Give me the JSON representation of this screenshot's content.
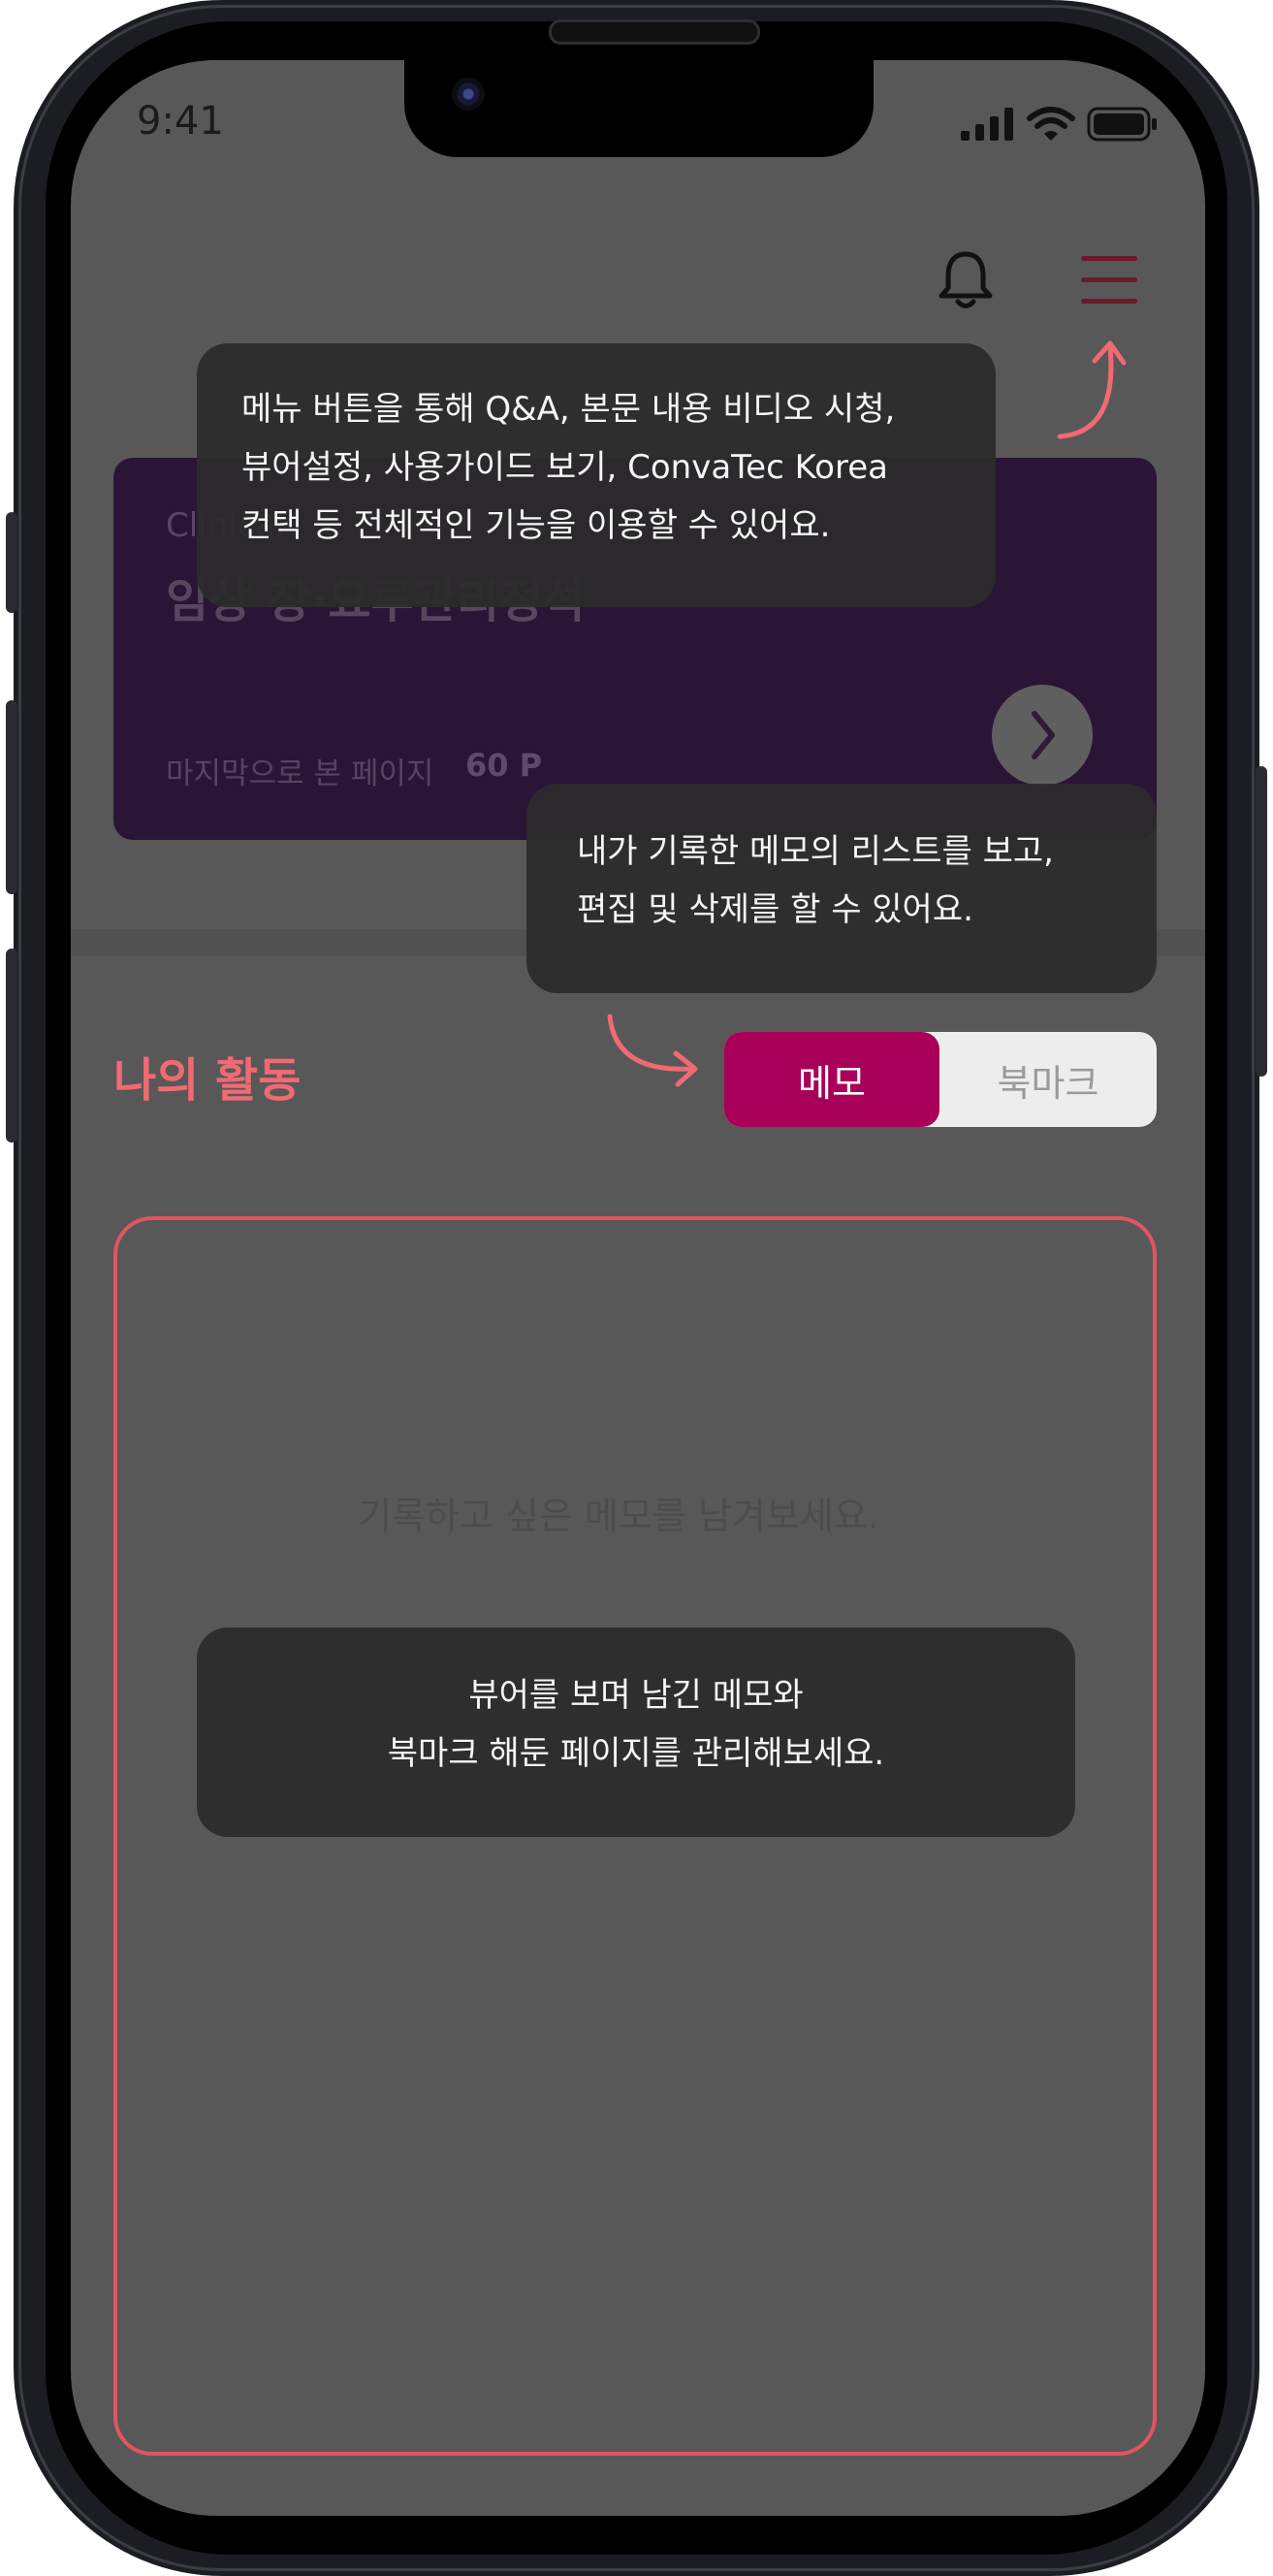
{
  "status_bar": {
    "time": "9:41"
  },
  "colors": {
    "accent_red": "#f06a73",
    "memo_tab_active": "#a80058",
    "card_bg": "#2a1536",
    "overlay": "#585858"
  },
  "header": {
    "notification_icon": "bell-icon",
    "menu_icon": "hamburger-menu-icon"
  },
  "book_card": {
    "subtitle": "Clinical",
    "title": "임상 장·요루관리정석",
    "last_viewed_label": "마지막으로 본 페이지",
    "last_viewed_page": "60 P",
    "arrow_icon": "chevron-right-icon"
  },
  "activity": {
    "title": "나의 활동",
    "tabs": [
      {
        "label": "메모",
        "selected": true
      },
      {
        "label": "북마크",
        "selected": false
      }
    ],
    "empty_message": "기록하고 싶은 메모를 남겨보세요."
  },
  "tooltips": {
    "menu": [
      "메뉴 버튼을 통해 Q&A, 본문 내용 비디오 시청,",
      "뷰어설정, 사용가이드 보기,  ConvaTec Korea",
      "컨택 등 전체적인 기능을 이용할 수 있어요."
    ],
    "memo": [
      "내가 기록한 메모의 리스트를 보고,",
      "편집 및 삭제를 할 수 있어요."
    ],
    "viewer": [
      "뷰어를 보며 남긴 메모와",
      "북마크 해둔 페이지를 관리해보세요."
    ]
  }
}
